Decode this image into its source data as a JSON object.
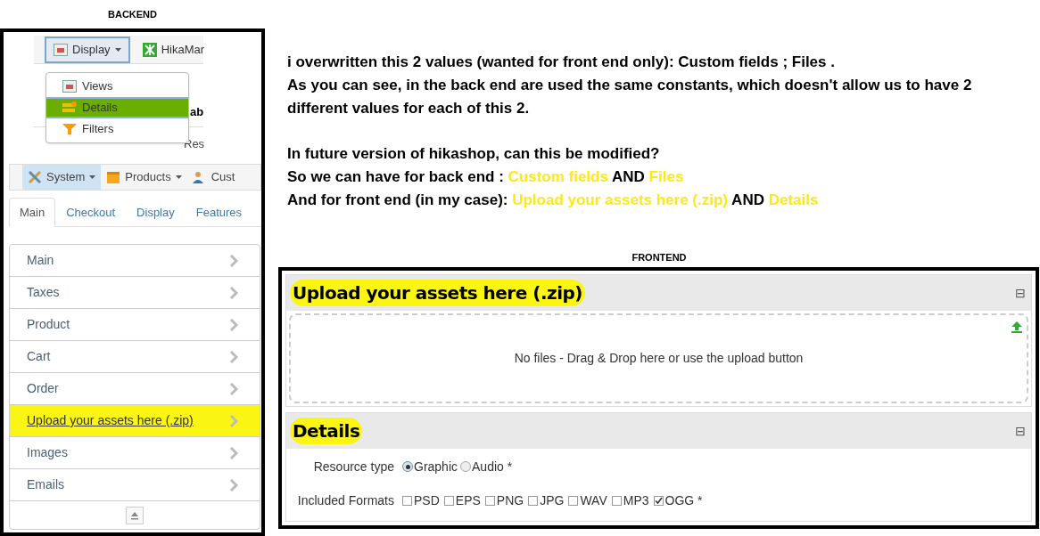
{
  "backend": {
    "label": "BACKEND",
    "top_toolbar": [
      {
        "label": "Display",
        "selected": true
      },
      {
        "label": "HikaMar",
        "selected": false
      }
    ],
    "dropdown": [
      {
        "label": "Views",
        "selected": false,
        "highlighted": false
      },
      {
        "label": "Details",
        "selected": true,
        "highlighted": true
      },
      {
        "label": "Filters",
        "selected": false,
        "highlighted": false
      }
    ],
    "behind_texts": [
      "ab",
      "Res"
    ],
    "menu_bar": [
      {
        "label": "System",
        "selected": true
      },
      {
        "label": "Products",
        "selected": false
      },
      {
        "label": "Cust",
        "selected": false
      }
    ],
    "tabs": [
      {
        "label": "Main",
        "selected": true
      },
      {
        "label": "Checkout",
        "selected": false
      },
      {
        "label": "Display",
        "selected": false
      },
      {
        "label": "Features",
        "selected": false
      }
    ],
    "list": [
      {
        "label": "Main",
        "highlighted": false
      },
      {
        "label": "Taxes",
        "highlighted": false
      },
      {
        "label": "Product",
        "highlighted": false
      },
      {
        "label": "Cart",
        "highlighted": false
      },
      {
        "label": "Order",
        "highlighted": false
      },
      {
        "label": "Upload your assets here (.zip)",
        "highlighted": true
      },
      {
        "label": "Images",
        "highlighted": false
      },
      {
        "label": "Emails",
        "highlighted": false
      }
    ]
  },
  "note": {
    "paragraphs": [
      [
        [
          {
            "text": "i overwritten this 2 values (wanted for front end only): Custom fields ; Files .",
            "highlighted": false
          }
        ],
        [
          {
            "text": "As you can see, in the back end are used the same constants, which doesn't allow us to have 2 different values for each of this 2.",
            "highlighted": false
          }
        ]
      ],
      [
        [
          {
            "text": "In future version of hikashop, can this be modified?",
            "highlighted": false
          }
        ],
        [
          {
            "text": "So we can have for back end : ",
            "highlighted": false
          },
          {
            "text": "Custom fields",
            "highlighted": true
          },
          {
            "text": " AND ",
            "highlighted": false
          },
          {
            "text": "Files",
            "highlighted": true
          }
        ],
        [
          {
            "text": "And for front end (in my case): ",
            "highlighted": false
          },
          {
            "text": "Upload your assets here (.zip)",
            "highlighted": true
          },
          {
            "text": " AND ",
            "highlighted": false
          },
          {
            "text": "Details",
            "highlighted": true
          }
        ]
      ]
    ]
  },
  "frontend": {
    "label": "FRONTEND",
    "upload_section": {
      "title": "Upload your assets here (.zip)",
      "highlighted": true,
      "collapse": "⊟",
      "dropzone": "No files - Drag & Drop here or use the upload button"
    },
    "details_section": {
      "title": "Details",
      "highlighted": true,
      "collapse": "⊟",
      "resource_type": {
        "label": "Resource type",
        "options": [
          {
            "label": "Graphic",
            "selected": true
          },
          {
            "label": "Audio *",
            "selected": false
          }
        ]
      },
      "formats": {
        "label": "Included Formats",
        "options": [
          {
            "label": "PSD",
            "checked": false
          },
          {
            "label": "EPS",
            "checked": false
          },
          {
            "label": "PNG",
            "checked": false
          },
          {
            "label": "JPG",
            "checked": false
          },
          {
            "label": "WAV",
            "checked": false
          },
          {
            "label": "MP3",
            "checked": false
          },
          {
            "label": "OGG *",
            "checked": true
          }
        ]
      }
    }
  }
}
